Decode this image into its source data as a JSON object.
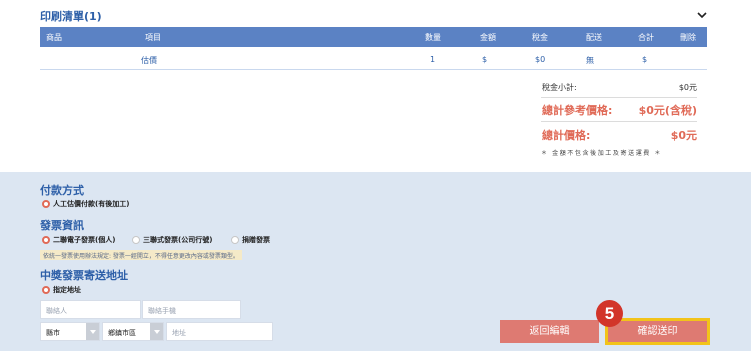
{
  "print_list": {
    "title": "印刷清單(1)",
    "columns": [
      "商品",
      "項目",
      "數量",
      "金額",
      "稅金",
      "配送",
      "合計",
      "刪除"
    ],
    "rows": [
      [
        "",
        "估價",
        "1",
        "$",
        "$0",
        "無",
        "$",
        ""
      ]
    ]
  },
  "summary": {
    "tax_subtotal_label": "稅金小計:",
    "tax_subtotal_value": "$0元",
    "ref_total_label": "總計參考價格:",
    "ref_total_value": "$0元(含稅)",
    "total_label": "總計價格:",
    "total_value": "$0元",
    "note": "＊ 金額不包含後加工及寄送運費 ＊"
  },
  "payment": {
    "title": "付款方式",
    "options": [
      {
        "label": "人工估價付款(有後加工)",
        "selected": true
      }
    ]
  },
  "invoice": {
    "title": "發票資訊",
    "options": [
      {
        "label": "二聯電子發票(個人)",
        "selected": true
      },
      {
        "label": "三聯式發票(公司行號)",
        "selected": false
      },
      {
        "label": "捐贈發票",
        "selected": false
      }
    ],
    "hint": "依統一發票使用辦法規定: 發票一經開立，不得任意更改內容或發票類型。"
  },
  "address": {
    "title": "中獎發票寄送地址",
    "options": [
      {
        "label": "指定地址",
        "selected": true
      }
    ],
    "contact_placeholder": "聯絡人",
    "phone_placeholder": "聯絡手機",
    "county_value": "縣市",
    "district_value": "鄉鎮市區",
    "address_placeholder": "地址"
  },
  "buttons": {
    "back_label": "返回編輯",
    "confirm_label": "確認送印",
    "step_number": "5"
  },
  "colors": {
    "accent_blue": "#2d5fa8",
    "header_blue": "#5b82c4",
    "price_red": "#e06a57",
    "button_red": "#de7a72",
    "highlight_yellow": "#f2c31a",
    "badge_red": "#d2352a"
  }
}
